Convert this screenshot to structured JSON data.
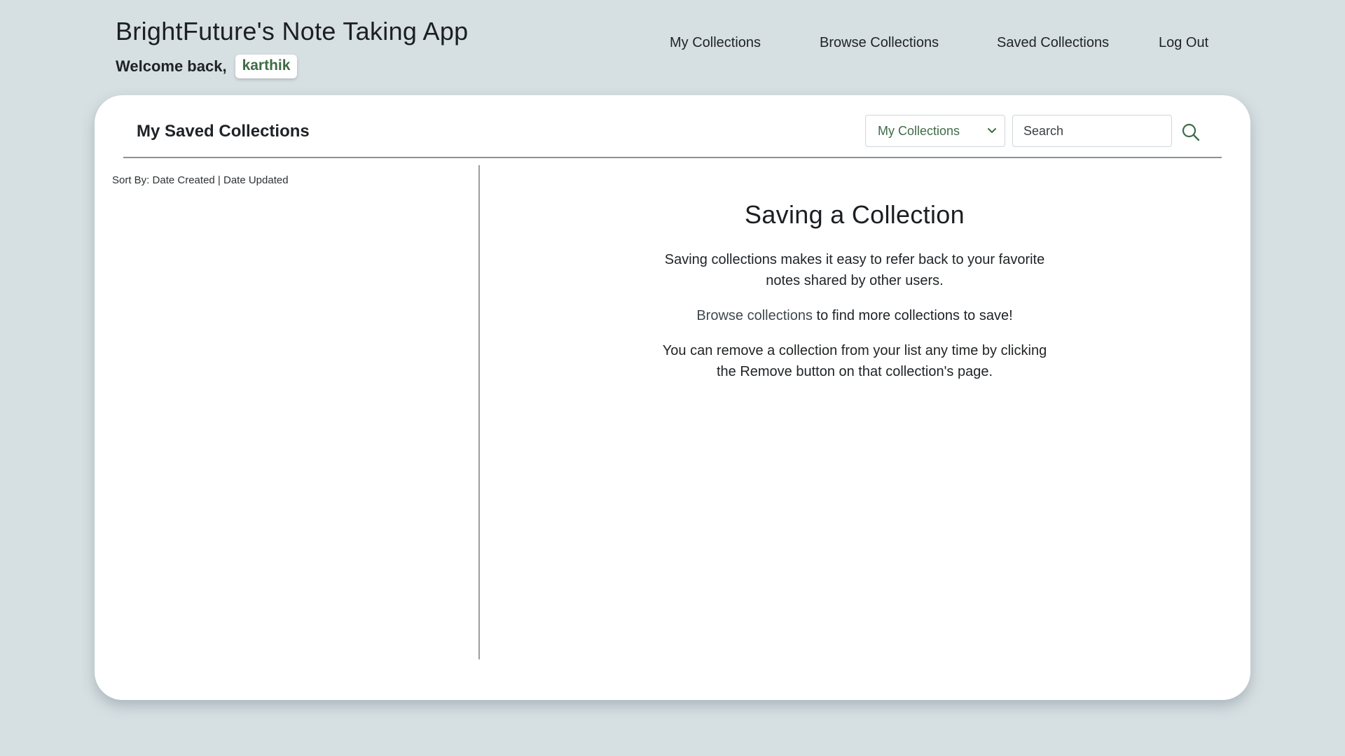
{
  "header": {
    "app_title": "BrightFuture's Note Taking App",
    "welcome_text": "Welcome back,",
    "username": "karthik"
  },
  "nav": {
    "items": [
      {
        "label": "My Collections"
      },
      {
        "label": "Browse Collections"
      },
      {
        "label": "Saved Collections"
      },
      {
        "label": "Log Out"
      }
    ]
  },
  "main": {
    "title": "My Saved Collections",
    "filter": {
      "selected": "My Collections",
      "icon": "chevron-down-icon"
    },
    "search": {
      "placeholder": "Search",
      "value": "",
      "icon": "search-icon"
    },
    "sort": {
      "label": "Sort By:",
      "options": [
        "Date Created",
        "Date Updated"
      ],
      "separator": "|"
    },
    "info": {
      "title": "Saving a Collection",
      "paragraph1": "Saving collections makes it easy to refer back to your favorite notes shared by other users.",
      "browse_link": "Browse collections",
      "paragraph2_rest": " to find more collections to save!",
      "paragraph3": "You can remove a collection from your list any time by clicking the Remove button on that collection's page."
    }
  },
  "colors": {
    "background": "#d6dfe2",
    "card": "#ffffff",
    "accent_green": "#3f6b46",
    "text": "#1f2326"
  }
}
